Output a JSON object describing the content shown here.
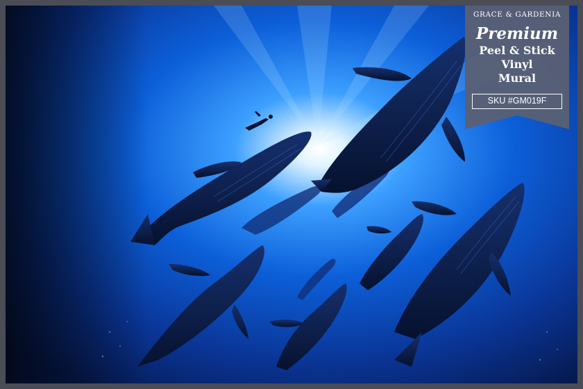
{
  "scene": {
    "description_icon": "whales-underwater-icon",
    "colors": {
      "deep": "#071236",
      "mid": "#0b3a9e",
      "light": "#2f8ef0",
      "glow": "#e8f6ff",
      "whale": "#0a1a46",
      "badge": "#5c6275",
      "frame": "#4a4d55"
    }
  },
  "badge": {
    "brand": "GRACE & GARDENIA",
    "premium": "Premium",
    "line1": "Peel & Stick",
    "line2": "Vinyl",
    "line3": "Mural",
    "sku": "SKU #GM019F"
  }
}
